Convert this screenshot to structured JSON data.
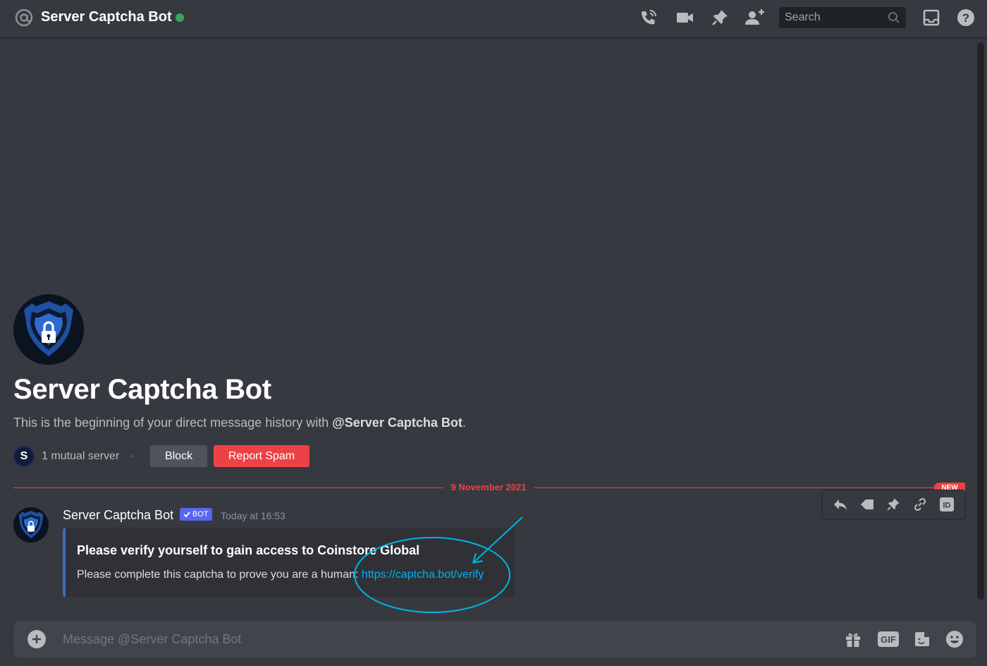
{
  "header": {
    "title": "Server Captcha Bot",
    "status": "online",
    "search_placeholder": "Search",
    "icons": [
      "at-icon",
      "call-icon",
      "video-icon",
      "pin-icon",
      "add-friend-icon",
      "search-icon",
      "inbox-icon",
      "help-icon"
    ]
  },
  "intro": {
    "name": "Server Captcha Bot",
    "text_prefix": "This is the beginning of your direct message history with ",
    "mention": "@Server Captcha Bot",
    "text_suffix": ".",
    "mutual": "1 mutual server",
    "mutual_server_initial": "S",
    "block_label": "Block",
    "report_label": "Report Spam"
  },
  "divider": {
    "date": "9 November 2021",
    "new_label": "NEW"
  },
  "message": {
    "author": "Server Captcha Bot",
    "bot_tag": "BOT",
    "timestamp": "Today at 16:53",
    "embed": {
      "title": "Please verify yourself to gain access to Coinstore Global",
      "description": "Please complete this captcha to prove you are a human: ",
      "link": "https://captcha.bot/verify"
    },
    "actions": [
      "reply-icon",
      "tag-icon",
      "pin-icon",
      "link-icon",
      "id-icon"
    ]
  },
  "composer": {
    "placeholder": "Message @Server Captcha Bot",
    "gif_label": "GIF"
  },
  "colors": {
    "background": "#36393f",
    "accent_red": "#ed4245",
    "bot_blue": "#5865f2",
    "link": "#00aff4",
    "annotation": "#00b4e6"
  }
}
